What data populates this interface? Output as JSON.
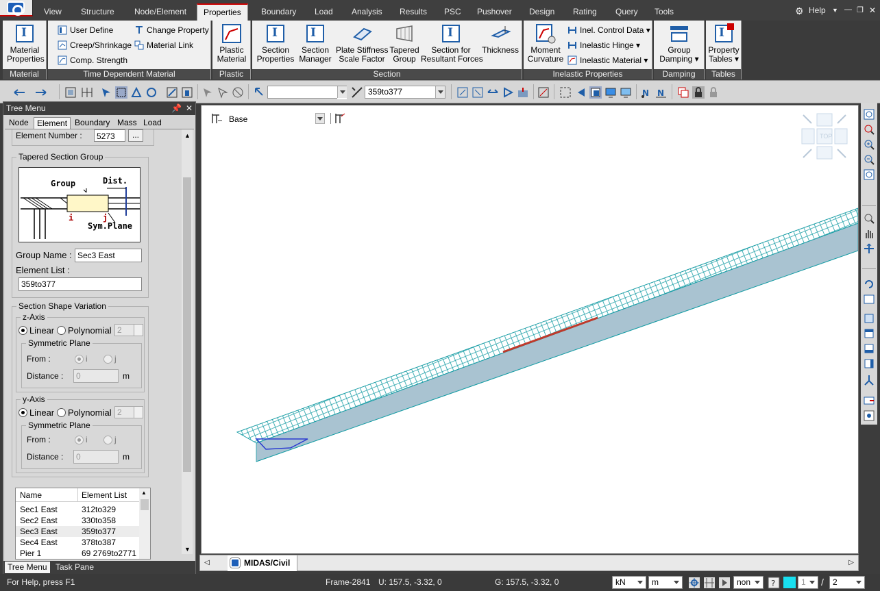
{
  "menu": {
    "tabs": [
      "View",
      "Structure",
      "Node/Element",
      "Properties",
      "Boundary",
      "Load",
      "Analysis",
      "Results",
      "PSC",
      "Pushover",
      "Design",
      "Rating",
      "Query",
      "Tools"
    ],
    "active": "Properties",
    "help": "Help"
  },
  "ribbon": {
    "groups": {
      "material": "Material",
      "time_dependent": "Time Dependent Material",
      "plastic": "Plastic",
      "section": "Section",
      "inelastic": "Inelastic Properties",
      "damping": "Damping",
      "tables": "Tables"
    },
    "buttons": {
      "material_properties": [
        "Material",
        "Properties"
      ],
      "user_define": "User Define",
      "creep_shrinkage": "Creep/Shrinkage",
      "comp_strength": "Comp. Strength",
      "change_property": "Change Property",
      "material_link": "Material Link",
      "plastic_material": [
        "Plastic",
        "Material"
      ],
      "section_properties": [
        "Section",
        "Properties"
      ],
      "section_manager": [
        "Section",
        "Manager"
      ],
      "plate_stiffness": [
        "Plate Stiffness",
        "Scale Factor"
      ],
      "tapered_group": [
        "Tapered",
        "Group"
      ],
      "section_resultant": [
        "Section for",
        "Resultant Forces"
      ],
      "thickness": "Thickness",
      "moment_curvature": [
        "Moment",
        "Curvature"
      ],
      "inel_control_data": "Inel. Control Data",
      "inelastic_hinge": "Inelastic Hinge",
      "inelastic_material": "Inelastic Material",
      "group_damping": [
        "Group",
        "Damping"
      ],
      "property_tables": [
        "Property",
        "Tables"
      ]
    }
  },
  "toolbar": {
    "select_combo": "",
    "element_combo": "359to377"
  },
  "tree_menu": {
    "title": "Tree Menu",
    "tabs": [
      "Node",
      "Element",
      "Boundary",
      "Mass",
      "Load"
    ],
    "active_tab": "Element",
    "element_number_label": "Element Number :",
    "element_number": "5273",
    "browse": "...",
    "tapered_section_group": "Tapered Section Group",
    "diagram": {
      "group": "Group",
      "dist": "Dist.",
      "i": "i",
      "j": "j",
      "sym_plane": "Sym.Plane"
    },
    "group_name_label": "Group Name :",
    "group_name": "Sec3 East",
    "element_list_label": "Element List :",
    "element_list": "359to377",
    "section_shape_variation": "Section Shape Variation",
    "z_axis": {
      "title": "z-Axis",
      "linear": "Linear",
      "polynomial": "Polynomial",
      "poly_value": "2",
      "symmetric_plane": "Symmetric Plane",
      "from": "From :",
      "i": "i",
      "j": "j",
      "distance": "Distance :",
      "distance_value": "0",
      "unit": "m"
    },
    "y_axis": {
      "title": "y-Axis",
      "linear": "Linear",
      "polynomial": "Polynomial",
      "poly_value": "2",
      "symmetric_plane": "Symmetric Plane",
      "from": "From :",
      "i": "i",
      "j": "j",
      "distance": "Distance :",
      "distance_value": "0",
      "unit": "m"
    },
    "list": {
      "headers": [
        "Name",
        "Element List"
      ],
      "rows": [
        [
          "Sec1 East",
          "312to329"
        ],
        [
          "Sec2 East",
          "330to358"
        ],
        [
          "Sec3 East",
          "359to377"
        ],
        [
          "Sec4 East",
          "378to387"
        ],
        [
          "Pier 1",
          "69 2769to2771"
        ]
      ],
      "selected": 2
    },
    "bottom_tabs": [
      "Tree Menu",
      "Task Pane"
    ]
  },
  "viewport": {
    "base_label": "Base",
    "cube_top": "TOP",
    "doc_tab": "MIDAS/Civil"
  },
  "status": {
    "help": "For Help, press F1",
    "frame": "Frame-2841",
    "u": "U: 157.5, -3.32, 0",
    "g": "G: 157.5, -3.32, 0",
    "force_unit": "kN",
    "length_unit": "m",
    "mode": "non",
    "page": "1",
    "slash": "/",
    "total": "2"
  },
  "colors": {
    "accent": "#c00000",
    "mesh": "#1a9ea6",
    "selected": "#c0392b",
    "icon_blue": "#1f5ea8"
  }
}
